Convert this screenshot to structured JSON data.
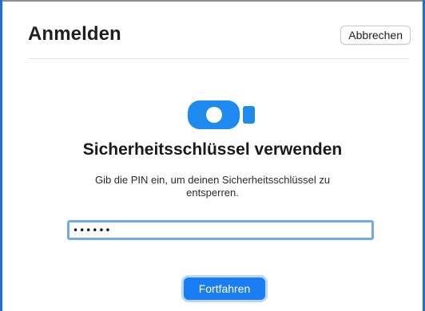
{
  "header": {
    "title": "Anmelden",
    "cancel_label": "Abbrechen"
  },
  "main": {
    "icon": "security-key-icon",
    "heading": "Sicherheitsschlüssel verwenden",
    "description": "Gib die PIN ein, um deinen Sicherheitsschlüssel zu entsperren.",
    "pin_value": "••••••",
    "continue_label": "Fortfahren"
  },
  "colors": {
    "accent": "#1a7ef2",
    "focus_ring": "#73a7ee",
    "icon": "#1e8af0"
  }
}
